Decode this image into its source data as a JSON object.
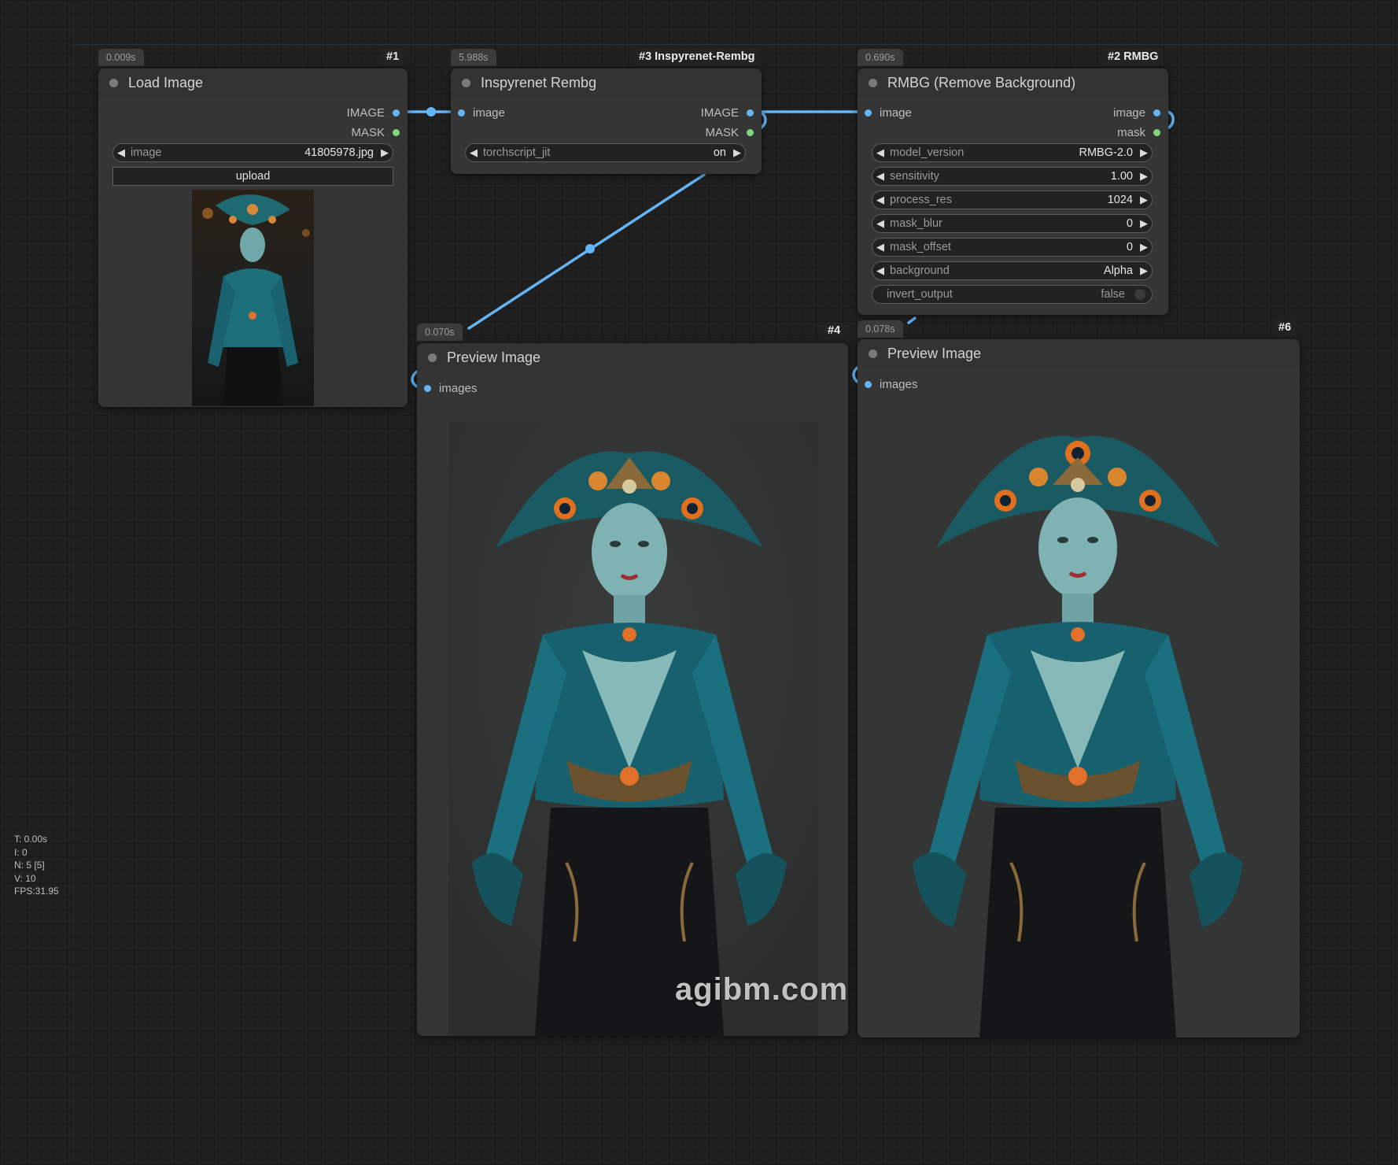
{
  "stats": {
    "t": "T: 0.00s",
    "i": "I: 0",
    "n": "N: 5 [5]",
    "v": "V: 10",
    "fps": "FPS:31.95"
  },
  "watermark": "agibm.com",
  "nodes": {
    "load_image": {
      "time": "0.009s",
      "id": "#1",
      "title": "Load Image",
      "outputs": [
        "IMAGE",
        "MASK"
      ],
      "image_widget": {
        "label": "image",
        "value": "41805978.jpg"
      },
      "upload_label": "upload"
    },
    "inspyrenet": {
      "time": "5.988s",
      "id": "#3 Inspyrenet-Rembg",
      "title": "Inspyrenet Rembg",
      "input": "image",
      "outputs": [
        "IMAGE",
        "MASK"
      ],
      "torchscript": {
        "label": "torchscript_jit",
        "value": "on"
      }
    },
    "rmbg": {
      "time": "0.690s",
      "id": "#2 RMBG",
      "title": "RMBG (Remove Background)",
      "input": "image",
      "outputs": [
        "image",
        "mask"
      ],
      "widgets": [
        {
          "label": "model_version",
          "value": "RMBG-2.0"
        },
        {
          "label": "sensitivity",
          "value": "1.00"
        },
        {
          "label": "process_res",
          "value": "1024"
        },
        {
          "label": "mask_blur",
          "value": "0"
        },
        {
          "label": "mask_offset",
          "value": "0"
        },
        {
          "label": "background",
          "value": "Alpha"
        }
      ],
      "toggle": {
        "label": "invert_output",
        "value": "false"
      }
    },
    "preview_4": {
      "time": "0.070s",
      "id": "#4",
      "title": "Preview Image",
      "input": "images"
    },
    "preview_6": {
      "time": "0.078s",
      "id": "#6",
      "title": "Preview Image",
      "input": "images"
    }
  },
  "colors": {
    "link": "#64b5f6",
    "image_slot": "#64b5f6",
    "mask_slot": "#7fd67f",
    "node_bg": "#353535",
    "canvas_bg": "#202020"
  }
}
